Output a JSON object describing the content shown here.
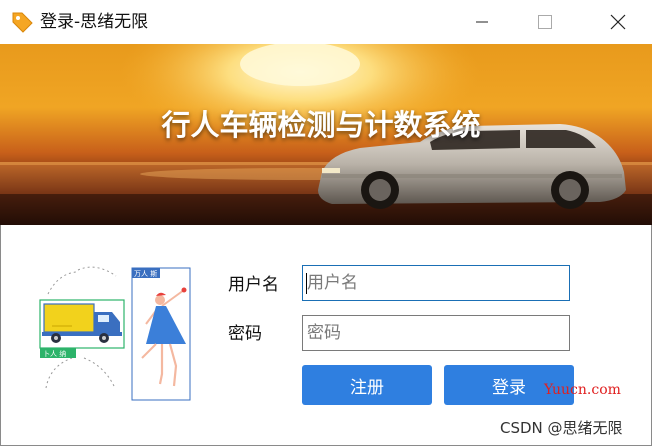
{
  "window": {
    "title": "登录-思绪无限",
    "icon": "tag-icon"
  },
  "banner": {
    "title": "行人车辆检测与计数系统"
  },
  "illustration": {
    "sign_label": "万人 斯",
    "truck_label": "卜人 纳"
  },
  "form": {
    "username_label": "用户名",
    "username_placeholder": "用户名",
    "password_label": "密码",
    "password_placeholder": "密码",
    "register_button": "注册",
    "login_button": "登录"
  },
  "watermarks": {
    "site": "Yuucn.com",
    "csdn": "CSDN @思绪无限"
  },
  "colors": {
    "button_blue": "#2f7fe0",
    "input_focus_border": "#1a6fb5",
    "icon_orange": "#f5a623",
    "site_watermark": "#e02020"
  }
}
